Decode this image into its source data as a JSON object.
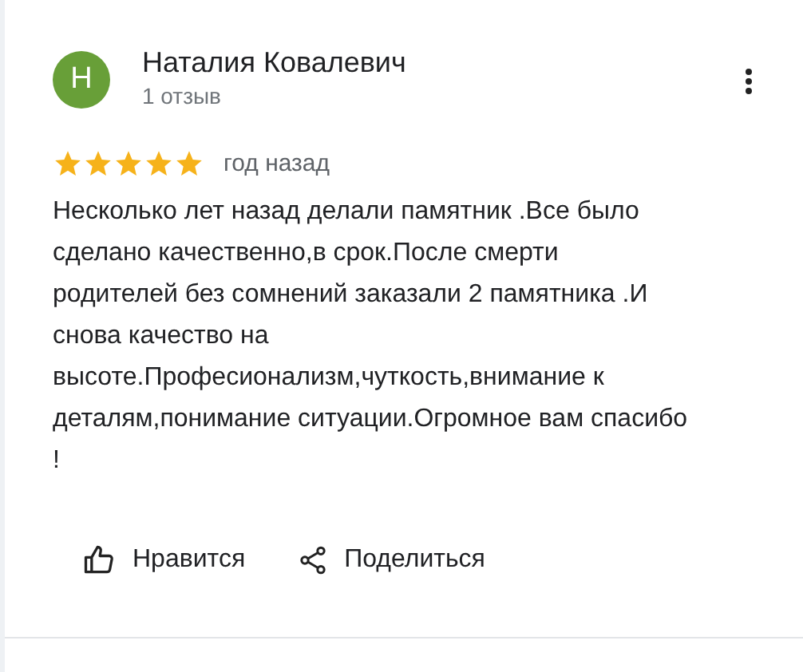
{
  "review": {
    "avatar_letter": "Н",
    "author": "Наталия Ковалевич",
    "author_meta": "1 отзыв",
    "stars": 5,
    "date": "год назад",
    "text": "Несколько лет назад делали памятник .Все было сделано качественно,в срок.После смерти родителей без сомнений заказали 2 памятника .И снова качество на высоте.Професионализм,чуткость,внимание к деталям,понимание ситуации.Огромное вам спасибо !"
  },
  "actions": [
    {
      "kind": "like",
      "label": "Нравится"
    },
    {
      "kind": "share",
      "label": "Поделиться"
    }
  ]
}
